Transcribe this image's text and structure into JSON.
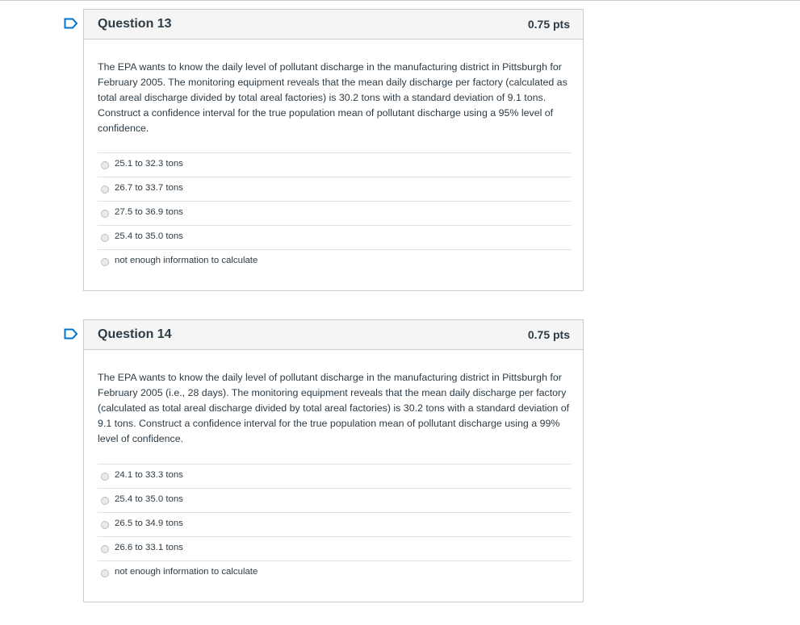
{
  "colors": {
    "flag_blue": "#0073c8",
    "border": "#c7cdd1",
    "header_bg": "#f5f5f5",
    "text": "#2d3b45"
  },
  "questions": [
    {
      "title": "Question 13",
      "points": "0.75 pts",
      "icon": "bookmark-flag-icon",
      "text": "The EPA wants to know the daily level of pollutant discharge in the manufacturing district in Pittsburgh for February 2005. The monitoring equipment reveals that the mean daily discharge per factory (calculated as total areal discharge divided by total areal factories) is 30.2 tons with a standard deviation of 9.1 tons. Construct a confidence interval for the true population mean of pollutant discharge using a 95% level of confidence.",
      "answers": [
        "25.1 to 32.3 tons",
        "26.7 to 33.7 tons",
        "27.5 to 36.9 tons",
        "25.4 to 35.0 tons",
        "not enough information to calculate"
      ]
    },
    {
      "title": "Question 14",
      "points": "0.75 pts",
      "icon": "bookmark-flag-icon",
      "text": "The EPA wants to know the daily level of pollutant discharge in the manufacturing district in Pittsburgh for February 2005 (i.e., 28 days). The monitoring equipment reveals that the mean daily discharge per factory (calculated as total areal discharge divided by total areal factories) is 30.2 tons with a standard deviation of 9.1 tons. Construct a confidence interval for the true population mean of pollutant discharge using a 99% level of confidence.",
      "answers": [
        "24.1 to 33.3 tons",
        "25.4 to 35.0 tons",
        "26.5 to 34.9 tons",
        "26.6 to 33.1 tons",
        "not enough information to calculate"
      ]
    }
  ]
}
